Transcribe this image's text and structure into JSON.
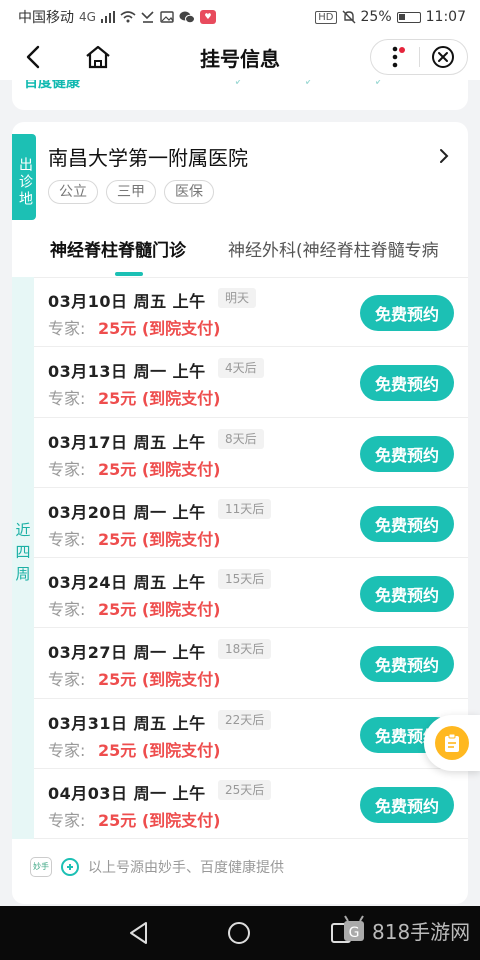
{
  "status_bar": {
    "carrier": "中国移动",
    "network": "4G",
    "battery": "25%",
    "time": "11:07"
  },
  "nav": {
    "title": "挂号信息"
  },
  "top_card": {
    "logo_text": "百度健康"
  },
  "hospital": {
    "badge": "出诊地",
    "name": "南昌大学第一附属医院",
    "tags": [
      "公立",
      "三甲",
      "医保"
    ]
  },
  "dept_tabs": [
    {
      "label": "神经脊柱脊髓门诊",
      "active": true
    },
    {
      "label": "神经外科(神经脊柱脊髓专病",
      "active": false
    }
  ],
  "week_label": "近四周",
  "slots": [
    {
      "date": "03月10日  周五  上午",
      "relative": "明天",
      "fee_label": "专家:",
      "fee": "25元 (到院支付)",
      "button": "免费预约"
    },
    {
      "date": "03月13日  周一  上午",
      "relative": "4天后",
      "fee_label": "专家:",
      "fee": "25元 (到院支付)",
      "button": "免费预约"
    },
    {
      "date": "03月17日  周五  上午",
      "relative": "8天后",
      "fee_label": "专家:",
      "fee": "25元 (到院支付)",
      "button": "免费预约"
    },
    {
      "date": "03月20日  周一  上午",
      "relative": "11天后",
      "fee_label": "专家:",
      "fee": "25元 (到院支付)",
      "button": "免费预约"
    },
    {
      "date": "03月24日  周五  上午",
      "relative": "15天后",
      "fee_label": "专家:",
      "fee": "25元 (到院支付)",
      "button": "免费预约"
    },
    {
      "date": "03月27日  周一  上午",
      "relative": "18天后",
      "fee_label": "专家:",
      "fee": "25元 (到院支付)",
      "button": "免费预约"
    },
    {
      "date": "03月31日  周五  上午",
      "relative": "22天后",
      "fee_label": "专家:",
      "fee": "25元 (到院支付)",
      "button": "免费预约"
    },
    {
      "date": "04月03日  周一  上午",
      "relative": "25天后",
      "fee_label": "专家:",
      "fee": "25元 (到院支付)",
      "button": "免费预约"
    }
  ],
  "footer": {
    "miao_logo": "妙手",
    "source_text": "以上号源由妙手、百度健康提供"
  },
  "watermark": "818手游网",
  "colors": {
    "accent": "#1cc0b4",
    "price": "#ee4d4d",
    "float_button": "#ffb820"
  }
}
